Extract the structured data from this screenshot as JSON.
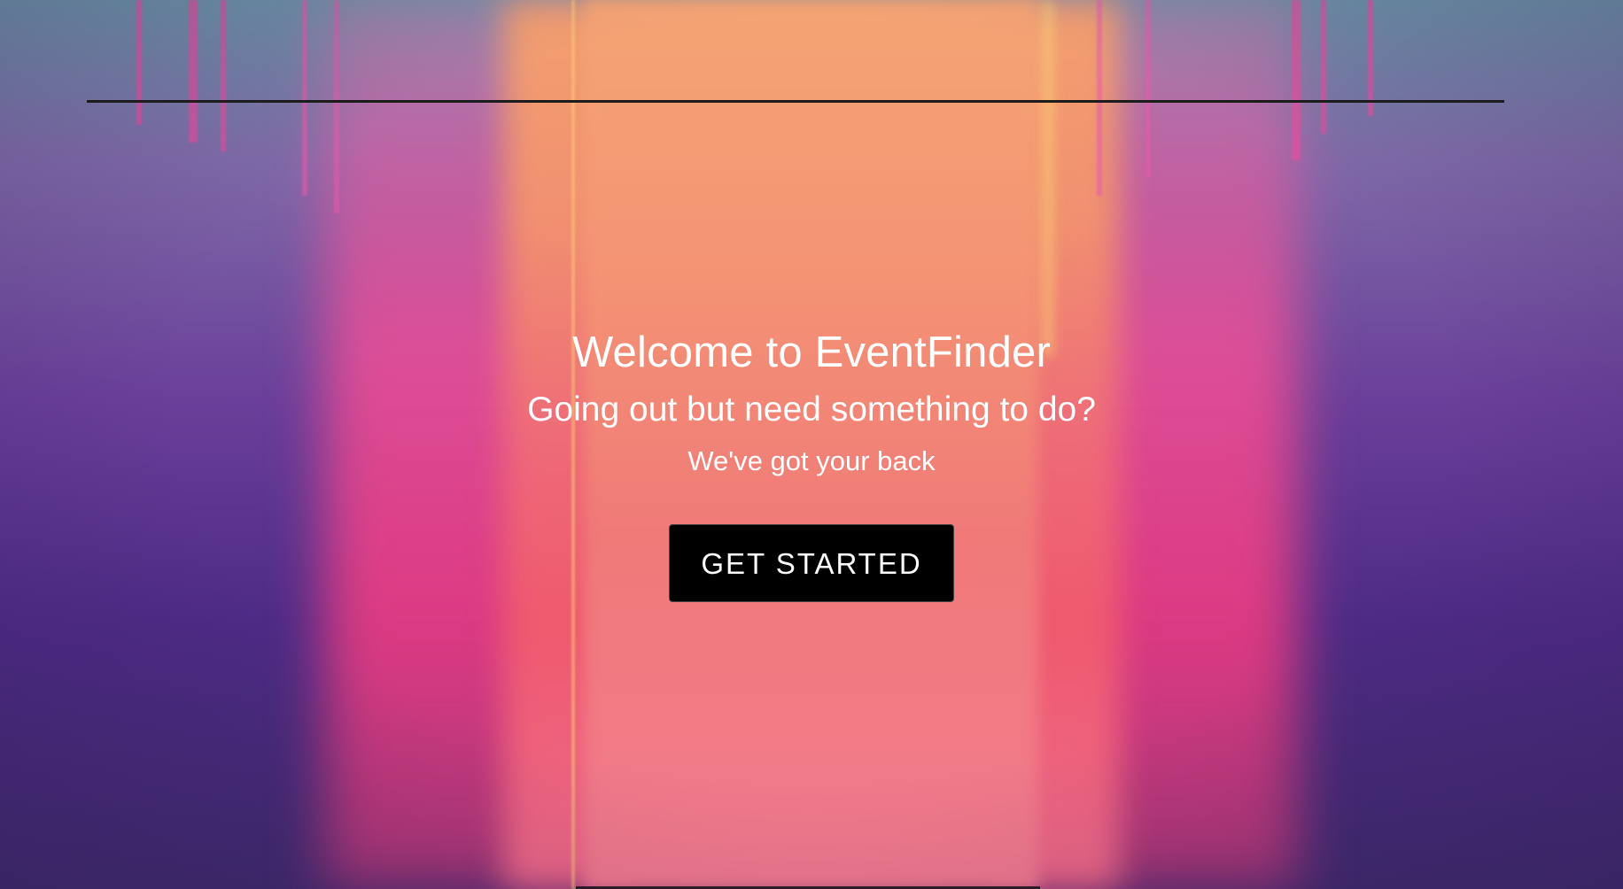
{
  "hero": {
    "title": "Welcome to EventFinder",
    "subtitle": "Going out but need something to do?",
    "tagline": "We've got your back",
    "cta_label": "GET STARTED"
  }
}
